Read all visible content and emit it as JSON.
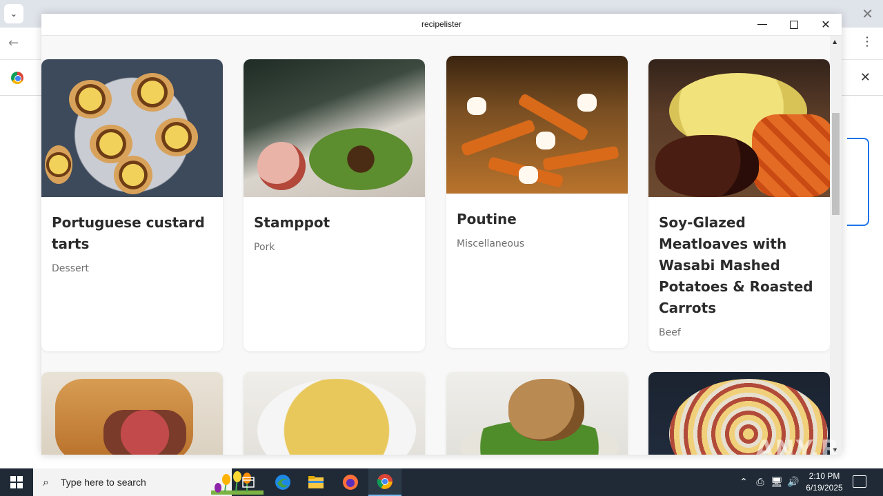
{
  "window": {
    "title": "recipelister",
    "controls": {
      "minimize": "minimize",
      "maximize": "maximize",
      "close": "close"
    }
  },
  "recipes": [
    {
      "name": "Portuguese custard tarts",
      "category": "Dessert"
    },
    {
      "name": "Stamppot",
      "category": "Pork"
    },
    {
      "name": "Poutine",
      "category": "Miscellaneous"
    },
    {
      "name": "Soy-Glazed Meatloaves with Wasabi Mashed Potatoes & Roasted Carrots",
      "category": "Beef"
    }
  ],
  "watermark": "ANY.RUN",
  "taskbar": {
    "search_placeholder": "Type here to search",
    "time": "2:10 PM",
    "date": "6/19/2025"
  },
  "colors": {
    "card_title": "#2b2b2b",
    "card_category": "#6f6f6f",
    "taskbar_bg": "#1f2a36",
    "browser_accent": "#1a73e8"
  }
}
